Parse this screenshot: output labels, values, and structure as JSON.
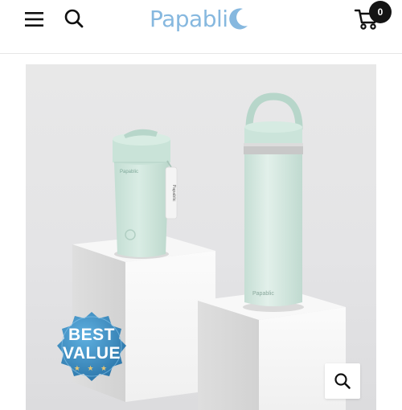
{
  "header": {
    "brand_name": "Papabli",
    "cart_count": "0",
    "icons": {
      "menu": "hamburger-menu-icon",
      "search": "search-icon",
      "cart": "cart-icon",
      "logo_mark": "crescent-moon-icon"
    }
  },
  "product_image": {
    "badge": {
      "line1": "BEST",
      "line2": "VALUE",
      "stars": "★ ★ ★"
    },
    "product_prints": {
      "tumbler_brand": "Papablic",
      "tumbler_tag": "Papablic",
      "bottle_brand": "Papablic"
    },
    "zoom_icon": "zoom-icon"
  },
  "colors": {
    "brand_blue": "#86b8df",
    "product_mint": "#cfe6dc",
    "badge_blue": "#3f8fc6",
    "badge_gold": "#e9c775"
  }
}
